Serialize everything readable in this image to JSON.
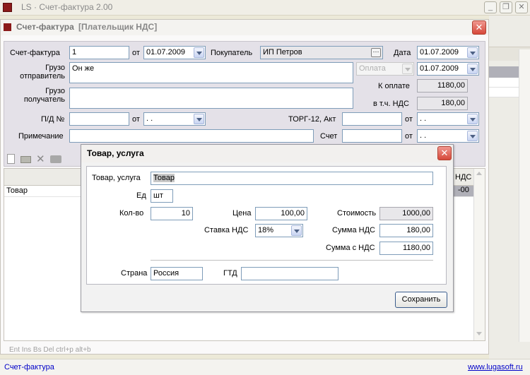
{
  "app": {
    "title": "LS · Счет-фактура 2.00"
  },
  "doc": {
    "title": "Счет-фактура",
    "subtitle": "[Плательщик НДС]",
    "invoice_label": "Счет-фактура",
    "invoice_value": "1",
    "ot_label": "от",
    "invoice_date": "01.07.2009",
    "buyer_label": "Покупатель",
    "buyer_value": "ИП Петров",
    "date_label": "Дата",
    "date_value": "01.07.2009",
    "shipper_label": "Грузо\nотправитель",
    "shipper_value": "Он же",
    "payment_select": "Оплата",
    "payment_date": "01.07.2009",
    "consignee_label": "Грузо\nполучатель",
    "consignee_value": "",
    "to_pay_label": "К оплате",
    "to_pay_value": "1180,00",
    "vat_incl_label": "в т.ч. НДС",
    "vat_incl_value": "180,00",
    "pd_label": "П/Д №",
    "pd_value": "",
    "pd_ot_label": "от",
    "pd_date": " .  .",
    "torg_label": "ТОРГ-12, Акт",
    "torg_value": "",
    "torg_ot_label": "от",
    "torg_date": " .  .",
    "note_label": "Примечание",
    "note_value": "",
    "account_label": "Счет",
    "account_value": "",
    "acc_ot_label": "от",
    "acc_date": " .  ."
  },
  "grid": {
    "vat_header": "НДС",
    "row_name": "Товар",
    "row_vat": "-00"
  },
  "hints": "Ent  Ins  Bs Del  ctrl+p  alt+b",
  "dialog": {
    "title": "Товар, услуга",
    "name_label": "Товар, услуга",
    "name_value": "Товар",
    "unit_label": "Ед",
    "unit_value": "шт",
    "qty_label": "Кол-во",
    "qty_value": "10",
    "price_label": "Цена",
    "price_value": "100,00",
    "cost_label": "Стоимость",
    "cost_value": "1000,00",
    "vat_rate_label": "Ставка НДС",
    "vat_rate_value": "18%",
    "vat_sum_label": "Сумма НДС",
    "vat_sum_value": "180,00",
    "sum_vat_label": "Сумма с НДС",
    "sum_vat_value": "1180,00",
    "country_label": "Страна",
    "country_value": "Россия",
    "gtd_label": "ГТД",
    "gtd_value": "",
    "save_label": "Сохранить"
  },
  "status": {
    "left": "Счет-фактура",
    "right": "www.lugasoft.ru"
  },
  "colors": {
    "accent": "#0000C8",
    "close": "#D6483A"
  }
}
